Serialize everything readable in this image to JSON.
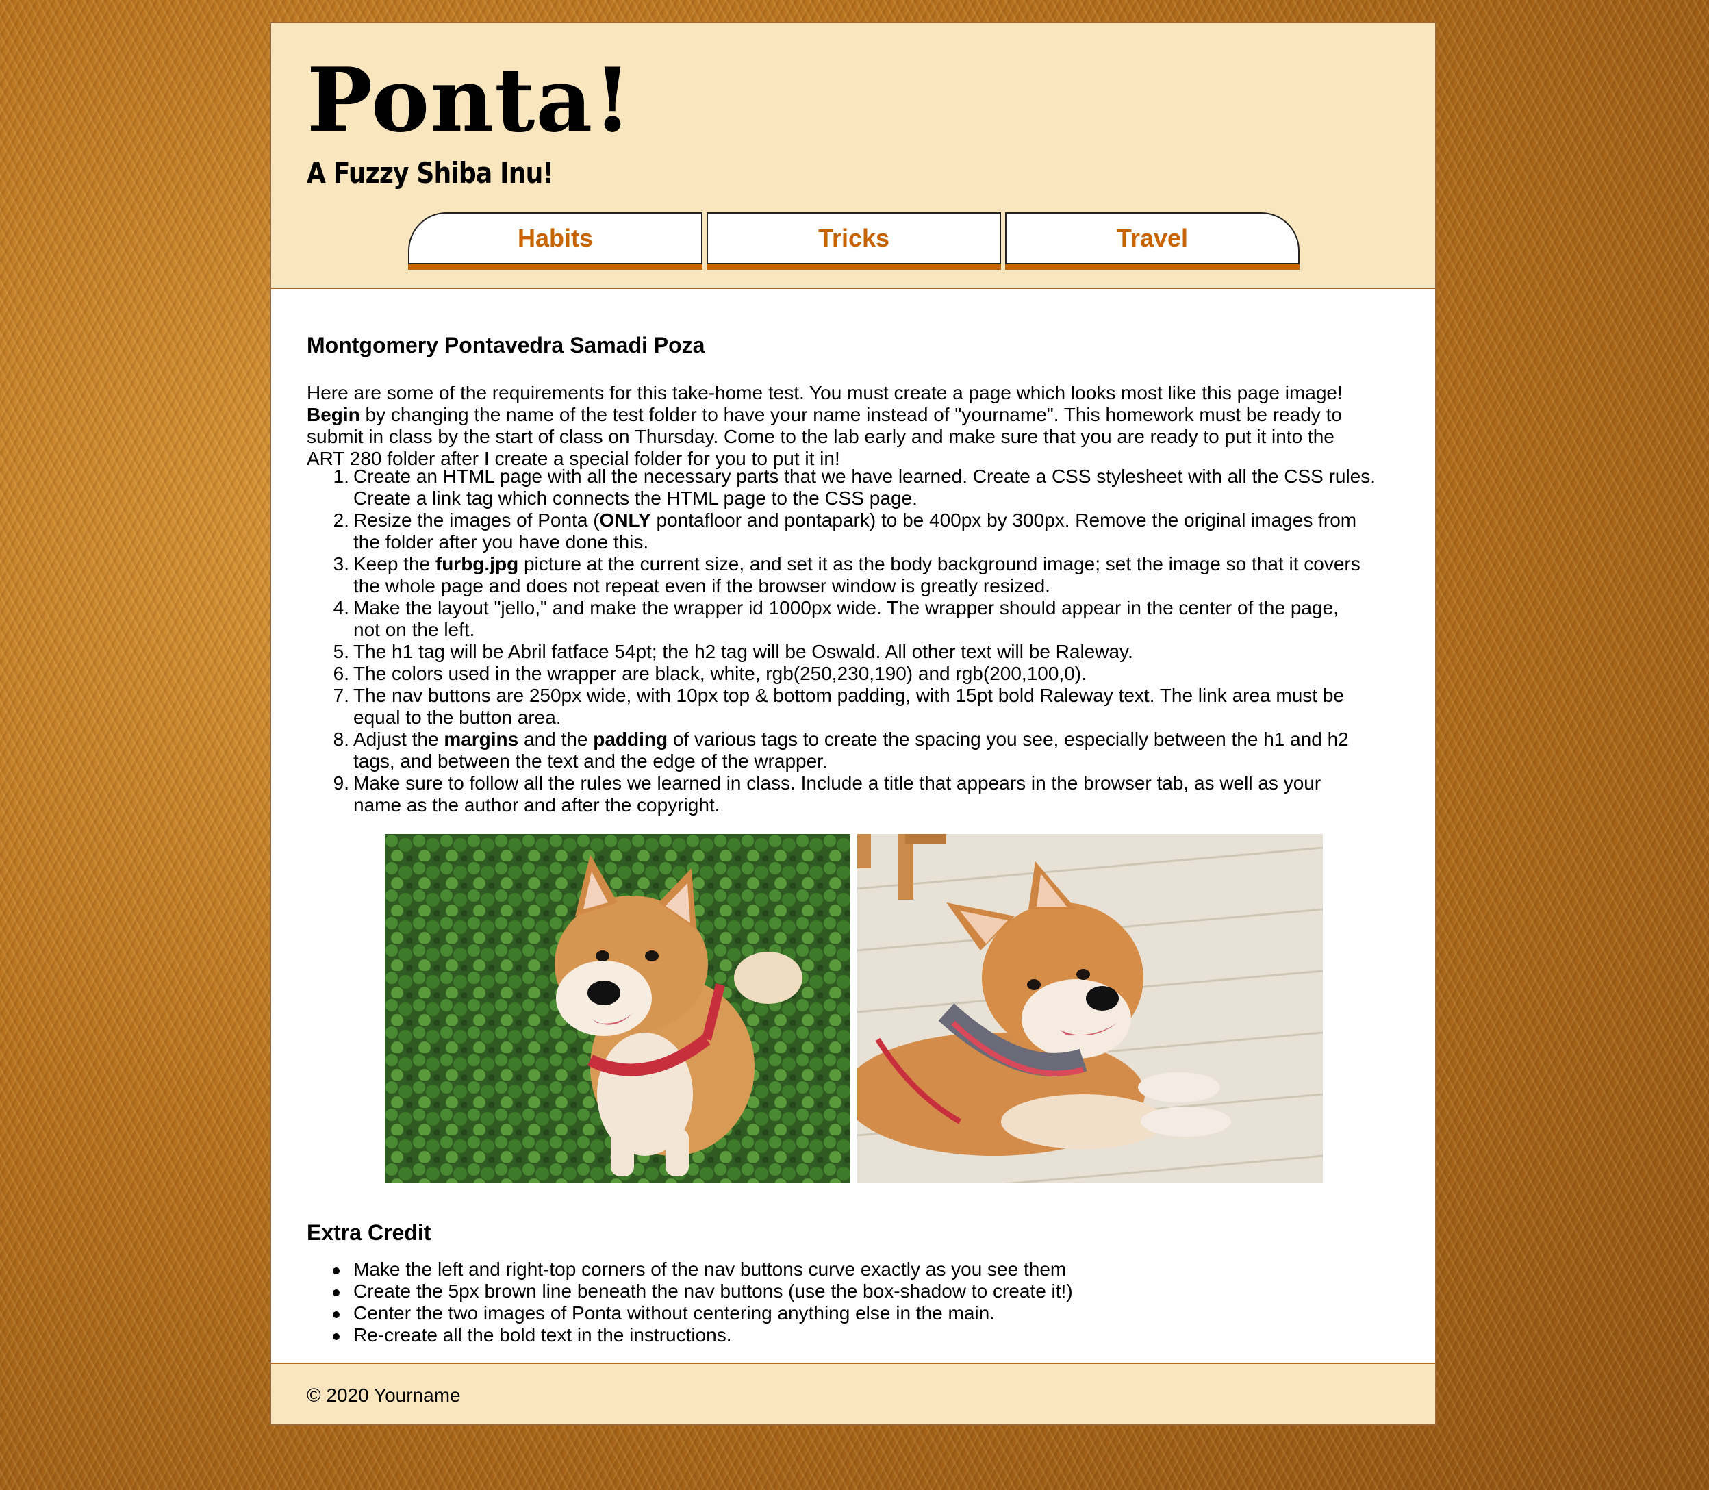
{
  "header": {
    "title": "Ponta!",
    "subtitle": "A Fuzzy Shiba Inu!",
    "nav": [
      {
        "label": "Habits"
      },
      {
        "label": "Tricks"
      },
      {
        "label": "Travel"
      }
    ]
  },
  "main": {
    "heading": "Montgomery Pontavedra Samadi Poza",
    "intro": {
      "line1": "Here are some of the requirements for this take-home test. You must create a page which looks most like this page image!",
      "line2_bold": "Begin",
      "line2": " by changing the name of the test folder to have your name instead of \"yourname\". This homework must be ready to",
      "line3": "submit in class by the start of class on Thursday. Come to the lab early and make sure that you are ready to put it into the",
      "line4": "ART 280 folder after I create a special folder for you to put it in!"
    },
    "requirements": [
      {
        "n": "1.",
        "l1": "Create an HTML page with all the necessary parts that we have learned. Create a CSS stylesheet with all the CSS rules.",
        "l2": "Create a link tag which connects the HTML page to the CSS page."
      },
      {
        "n": "2.",
        "a": "Resize the images of Ponta (",
        "b": "ONLY",
        "c": " pontafloor and pontapark) to be 400px by 300px. Remove the original images from",
        "l2": "the folder after you have done this."
      },
      {
        "n": "3.",
        "a": "Keep the ",
        "b": "furbg.jpg",
        "c": " picture at the current size, and set it as the body background image; set the image so that it covers",
        "l2": "the whole page and does not repeat even if the browser window is greatly resized."
      },
      {
        "n": "4.",
        "l1": "Make the layout \"jello,\" and make the wrapper id 1000px wide. The wrapper should appear in the center of the page,",
        "l2": "not on the left."
      },
      {
        "n": "5.",
        "l1": "The h1 tag will be Abril fatface 54pt; the h2 tag will be Oswald. All other text will be Raleway."
      },
      {
        "n": "6.",
        "l1": "The colors used in the wrapper are black, white, rgb(250,230,190) and rgb(200,100,0)."
      },
      {
        "n": "7.",
        "l1": "The nav buttons are 250px wide, with 10px top & bottom padding, with 15pt bold Raleway text. The link area must be",
        "l2": "equal to the button area."
      },
      {
        "n": "8.",
        "a": "Adjust the ",
        "b": "margins",
        "c": " and the ",
        "d": "padding",
        "e": " of various tags to create the spacing you see, especially between the h1 and h2",
        "l2": "tags, and between the text and the edge of the wrapper."
      },
      {
        "n": "9.",
        "l1": "Make sure to follow all the rules we learned in class. Include a title that appears in the browser tab, as well as your",
        "l2": "name as the author and after the copyright."
      }
    ],
    "extra_heading": "Extra Credit",
    "extra": [
      "Make the left and right-top corners of the nav buttons curve exactly as you see them",
      "Create the 5px brown line beneath the nav buttons (use the box-shadow to create it!)",
      "Center the two images of Ponta without centering anything else in the main.",
      "Re-create all the bold text in the instructions."
    ]
  },
  "footer": {
    "copyright": "© 2020 Yourname"
  },
  "colors": {
    "cream": "#fae6be",
    "accent": "#c86400"
  }
}
